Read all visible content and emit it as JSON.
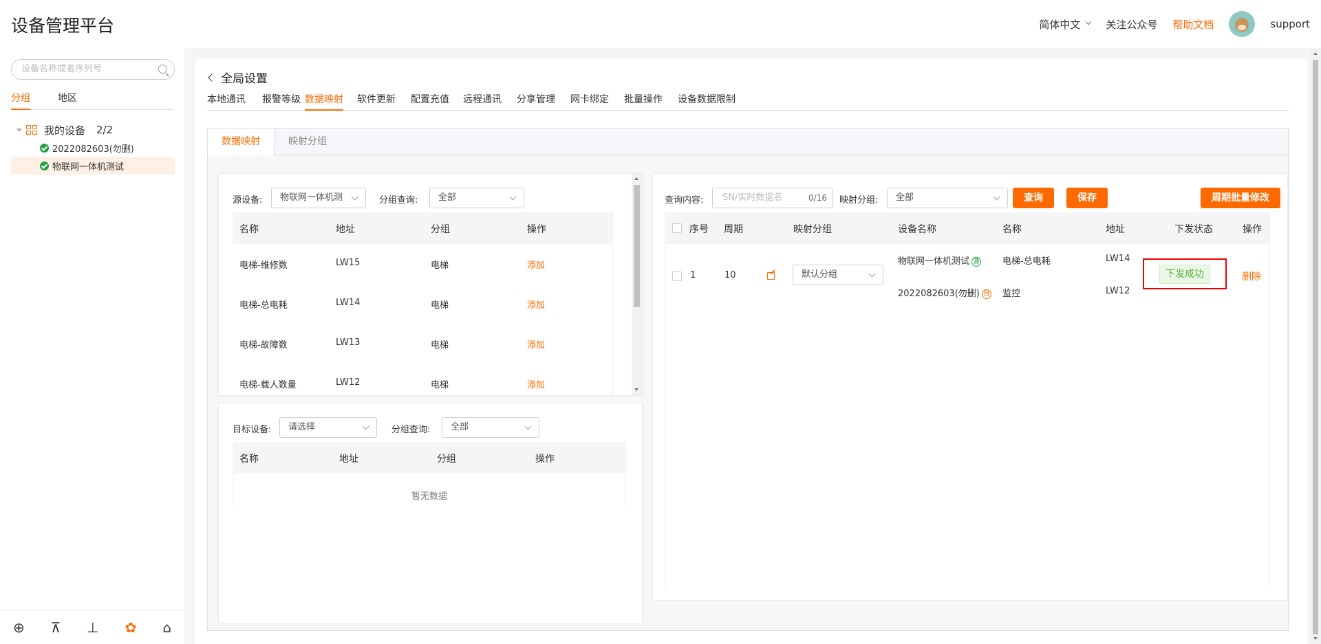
{
  "header": {
    "title": "设备管理平台",
    "language": "简体中文",
    "follow": "关注公众号",
    "help": "帮助文档",
    "user": "support"
  },
  "sidebar": {
    "search_placeholder": "设备名称或者序列号",
    "tabs": [
      "分组",
      "地区"
    ],
    "tree": {
      "root_label": "我的设备",
      "root_count": "2/2",
      "children": [
        "2022082603(勿删)",
        "物联网一体机测试"
      ]
    },
    "bottom_icons": [
      "add-icon",
      "org-tree-icon",
      "chart-icon",
      "gear-icon",
      "home-icon"
    ]
  },
  "page": {
    "back_title": "全局设置",
    "tabs": [
      "本地通讯",
      "报警等级",
      "数据映射",
      "软件更新",
      "配置充值",
      "远程通讯",
      "分享管理",
      "网卡绑定",
      "批量操作",
      "设备数据限制"
    ],
    "active_tab": "数据映射",
    "subtabs": [
      "数据映射",
      "映射分组"
    ]
  },
  "source": {
    "device_label": "源设备:",
    "device_value": "物联网一体机测",
    "group_label": "分组查询:",
    "group_value": "全部",
    "columns": [
      "名称",
      "地址",
      "分组",
      "操作"
    ],
    "rows": [
      {
        "name": "电梯-维修数",
        "addr": "LW15",
        "group": "电梯",
        "op": "添加"
      },
      {
        "name": "电梯-总电耗",
        "addr": "LW14",
        "group": "电梯",
        "op": "添加"
      },
      {
        "name": "电梯-故障数",
        "addr": "LW13",
        "group": "电梯",
        "op": "添加"
      },
      {
        "name": "电梯-载人数量",
        "addr": "LW12",
        "group": "电梯",
        "op": "添加"
      }
    ]
  },
  "target": {
    "device_label": "目标设备:",
    "device_value": "请选择",
    "group_label": "分组查询:",
    "group_value": "全部",
    "columns": [
      "名称",
      "地址",
      "分组",
      "操作"
    ],
    "empty": "暂无数据"
  },
  "mapping": {
    "query_label": "查询内容:",
    "query_placeholder": "SN/实时数据名",
    "query_count": "0/16",
    "group_label": "映射分组:",
    "group_value": "全部",
    "btn_query": "查询",
    "btn_save": "保存",
    "btn_batch": "周期批量修改",
    "columns": [
      "序号",
      "周期",
      "映射分组",
      "设备名称",
      "名称",
      "地址",
      "下发状态",
      "操作"
    ],
    "row": {
      "index": "1",
      "period": "10",
      "group": "默认分组",
      "src_device": "物联网一体机测试",
      "src_badge": "源",
      "tgt_device": "2022082603(勿删)",
      "tgt_badge": "目",
      "src_name": "电梯-总电耗",
      "tgt_name": "监控",
      "src_addr": "LW14",
      "tgt_addr": "LW12",
      "status": "下发成功",
      "op": "删除"
    }
  },
  "colors": {
    "accent": "#ff6a00",
    "success": "#52b030",
    "highlight": "#e00000"
  }
}
